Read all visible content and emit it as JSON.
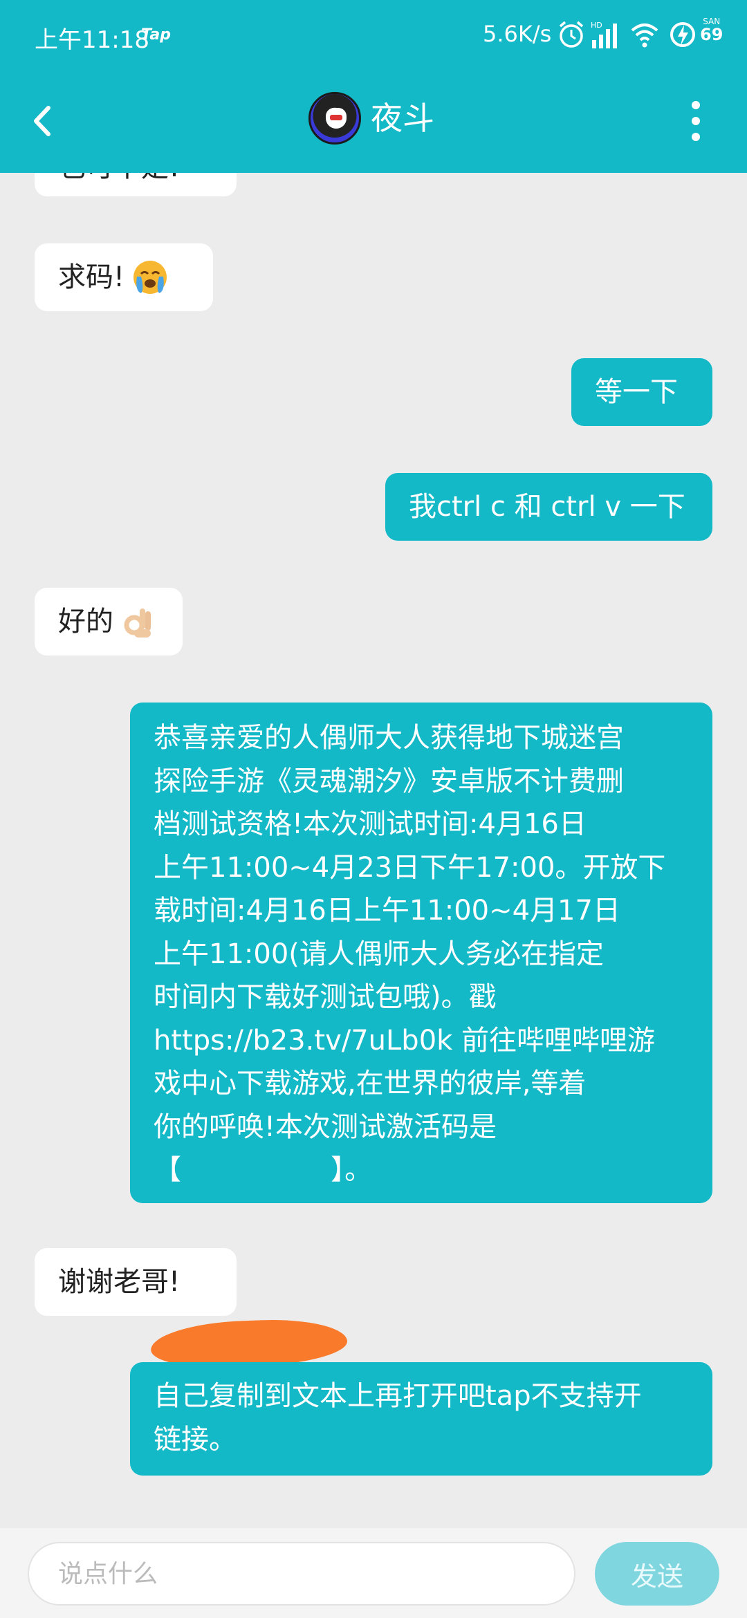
{
  "status_bar": {
    "time": "上午11:18",
    "app_tag": "Tap",
    "net_speed": "5.6K/s",
    "hd": "HD",
    "san_label": "SAN",
    "san_value": "69"
  },
  "header": {
    "contact_name": "夜斗",
    "accent": "#14b9c8"
  },
  "messages": [
    {
      "side": "in",
      "text": "也可不是!"
    },
    {
      "side": "in",
      "text": "求码!",
      "emoji": "crying-face"
    },
    {
      "side": "out",
      "text": "等一下"
    },
    {
      "side": "out",
      "text": "我ctrl c 和 ctrl v 一下"
    },
    {
      "side": "in",
      "text": "好的",
      "emoji": "ok-hand"
    },
    {
      "side": "out",
      "lines": [
        "恭喜亲爱的人偶师大人获得地下城迷宫",
        "探险手游《灵魂潮汐》安卓版不计费删",
        "档测试资格!本次测试时间:4月16日",
        "上午11:00~4月23日下午17:00。开放下",
        "载时间:4月16日上午11:00~4月17日",
        "上午11:00(请人偶师大人务必在指定",
        "时间内下载好测试包哦)。戳",
        "https://b23.tv/7uLb0k 前往哔哩哔哩游",
        "戏中心下载游戏,在世界的彼岸,等着",
        "你的呼唤!本次测试激活码是",
        "【                 】。"
      ]
    },
    {
      "side": "in",
      "text": "谢谢老哥!"
    },
    {
      "side": "out",
      "lines": [
        "自己复制到文本上再打开吧tap不支持开",
        "链接。"
      ]
    }
  ],
  "composer": {
    "placeholder": "说点什么",
    "send_label": "发送"
  }
}
